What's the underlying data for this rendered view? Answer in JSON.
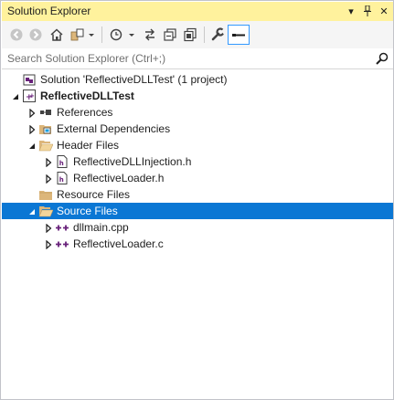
{
  "window": {
    "title": "Solution Explorer",
    "dropdown_glyph": "▾",
    "pin_glyph": "⊥",
    "close_glyph": "✕"
  },
  "colors": {
    "titlebar_bg": "#fff29d",
    "selection_bg": "#0b77d4",
    "folder": "#dcb67a",
    "cpp_icon": "#68217a"
  },
  "toolbar": {
    "buttons": [
      "back",
      "forward",
      "home",
      "switch-views",
      "pending-changes-filter",
      "collapse-all",
      "show-all-files",
      "properties",
      "preview-selected-items"
    ]
  },
  "search": {
    "placeholder": "Search Solution Explorer (Ctrl+;)",
    "value": ""
  },
  "tree": [
    {
      "label": "Solution 'ReflectiveDLLTest' (1 project)",
      "icon": "solution-icon",
      "expander": "none",
      "bold": false,
      "selected": false
    },
    {
      "label": "ReflectiveDLLTest",
      "icon": "cpp-project-icon",
      "expander": "expanded",
      "bold": true,
      "selected": false
    },
    {
      "label": "References",
      "icon": "references-icon",
      "expander": "collapsed",
      "bold": false,
      "selected": false
    },
    {
      "label": "External Dependencies",
      "icon": "external-dependencies-icon",
      "expander": "collapsed",
      "bold": false,
      "selected": false
    },
    {
      "label": "Header Files",
      "icon": "folder-open-icon",
      "expander": "expanded",
      "bold": false,
      "selected": false
    },
    {
      "label": "ReflectiveDLLInjection.h",
      "icon": "header-file-icon",
      "expander": "collapsed",
      "bold": false,
      "selected": false
    },
    {
      "label": "ReflectiveLoader.h",
      "icon": "header-file-icon",
      "expander": "collapsed",
      "bold": false,
      "selected": false
    },
    {
      "label": "Resource Files",
      "icon": "folder-icon",
      "expander": "none",
      "bold": false,
      "selected": false
    },
    {
      "label": "Source Files",
      "icon": "folder-open-icon",
      "expander": "expanded",
      "bold": false,
      "selected": true
    },
    {
      "label": "dllmain.cpp",
      "icon": "cpp-file-icon",
      "expander": "collapsed",
      "bold": false,
      "selected": false
    },
    {
      "label": "ReflectiveLoader.c",
      "icon": "cpp-file-icon",
      "expander": "collapsed",
      "bold": false,
      "selected": false
    }
  ]
}
